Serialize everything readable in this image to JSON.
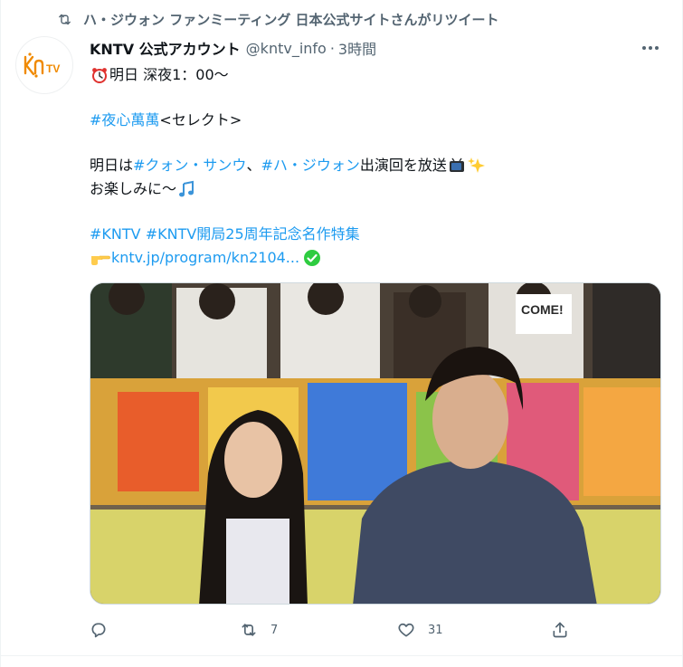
{
  "retweet_banner": {
    "icon": "retweet-icon",
    "text": "ハ・ジウォン ファンミーティング 日本公式サイトさんがリツイート"
  },
  "author": {
    "avatar_logo_text": "KNTV",
    "name": "KNTV 公式アカウント",
    "handle": "@kntv_info",
    "separator": "·",
    "time": "3時間"
  },
  "tweet": {
    "line1": {
      "emoji": "alarm-clock-emoji",
      "text": "明日 深夜1：00～"
    },
    "line2": {
      "hashtag": "#夜心萬萬",
      "text": " <セレクト>"
    },
    "line3": {
      "t1": "明日は ",
      "tag1": "#クォン・サンウ",
      "t2": "、",
      "tag2": "#ハ・ジウォン",
      "t3": " 出演回を放送",
      "emojis": [
        "television-emoji",
        "sparkles-emoji"
      ]
    },
    "line4": {
      "text": "お楽しみに～",
      "emoji": "musical-note-emoji"
    },
    "line5": {
      "tag1": "#KNTV",
      "tag2": "#KNTV開局25周年記念名作特集"
    },
    "line6": {
      "emoji": "pointing-hand-emoji",
      "link": "kntv.jp/program/kn2104...",
      "check": "check-mark-emoji"
    }
  },
  "media": {
    "kind": "tv-show-still",
    "banner_text": "COME!"
  },
  "actions": {
    "reply": {
      "icon": "reply-icon",
      "count": ""
    },
    "retweet": {
      "icon": "retweet-icon",
      "count": "7"
    },
    "like": {
      "icon": "heart-icon",
      "count": "31"
    },
    "share": {
      "icon": "share-icon"
    }
  },
  "colors": {
    "link": "#1d9bf0",
    "secondary": "#536471",
    "brand_orange": "#f08a00",
    "check_green": "#2ecc40"
  }
}
